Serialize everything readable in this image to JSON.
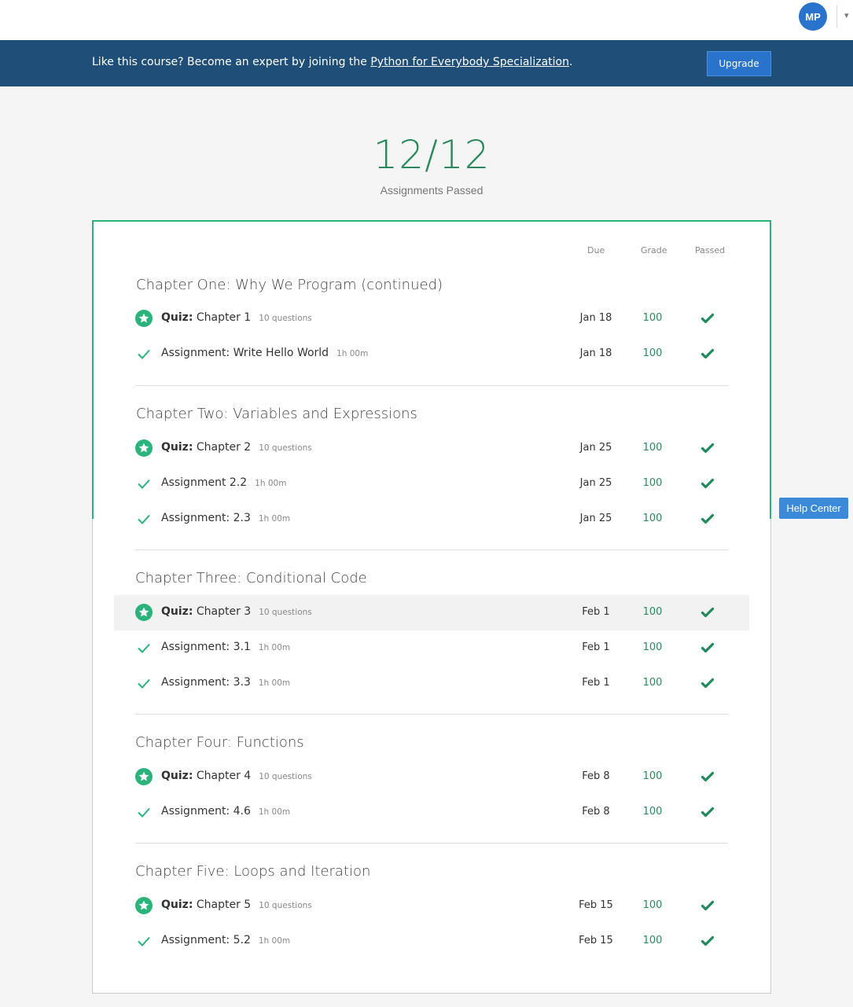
{
  "topbar": {
    "avatar_initials": "MP",
    "dropdown_icon": "chevron-down-icon"
  },
  "banner": {
    "text_before": "Like this course? Become an expert by joining the ",
    "link_text": "Python for Everybody Specialization",
    "text_after": ".",
    "upgrade_label": "Upgrade"
  },
  "summary": {
    "score": "12/12",
    "label": "Assignments Passed"
  },
  "columns": {
    "due": "Due",
    "grade": "Grade",
    "passed": "Passed"
  },
  "colors": {
    "accent": "#2a8a5c",
    "banner": "#1f4e79",
    "button": "#2a73cc",
    "help": "#3b8ad9"
  },
  "chapters": [
    {
      "title": "Chapter One: Why We Program (continued)",
      "items": [
        {
          "kind": "Quiz:",
          "name": "Chapter 1",
          "meta": "10 questions",
          "due": "Jan 18",
          "grade": "100",
          "icon": "star-badge-icon"
        },
        {
          "kind": "",
          "name": "Assignment: Write Hello World",
          "meta": "1h 00m",
          "due": "Jan 18",
          "grade": "100",
          "icon": "check-icon"
        }
      ]
    },
    {
      "title": "Chapter Two: Variables and Expressions",
      "items": [
        {
          "kind": "Quiz:",
          "name": "Chapter 2",
          "meta": "10 questions",
          "due": "Jan 25",
          "grade": "100",
          "icon": "star-badge-icon"
        },
        {
          "kind": "",
          "name": "Assignment 2.2",
          "meta": "1h 00m",
          "due": "Jan 25",
          "grade": "100",
          "icon": "check-icon"
        },
        {
          "kind": "",
          "name": "Assignment: 2.3",
          "meta": "1h 00m",
          "due": "Jan 25",
          "grade": "100",
          "icon": "check-icon"
        }
      ]
    },
    {
      "title": "Chapter Three: Conditional Code",
      "items": [
        {
          "kind": "Quiz:",
          "name": "Chapter 3",
          "meta": "10 questions",
          "due": "Feb 1",
          "grade": "100",
          "icon": "star-badge-icon"
        },
        {
          "kind": "",
          "name": "Assignment: 3.1",
          "meta": "1h 00m",
          "due": "Feb 1",
          "grade": "100",
          "icon": "check-icon"
        },
        {
          "kind": "",
          "name": "Assignment: 3.3",
          "meta": "1h 00m",
          "due": "Feb 1",
          "grade": "100",
          "icon": "check-icon"
        }
      ]
    },
    {
      "title": "Chapter Four: Functions",
      "items": [
        {
          "kind": "Quiz:",
          "name": "Chapter 4",
          "meta": "10 questions",
          "due": "Feb 8",
          "grade": "100",
          "icon": "star-badge-icon"
        },
        {
          "kind": "",
          "name": "Assignment: 4.6",
          "meta": "1h 00m",
          "due": "Feb 8",
          "grade": "100",
          "icon": "check-icon"
        }
      ]
    },
    {
      "title": "Chapter Five: Loops and Iteration",
      "items": [
        {
          "kind": "Quiz:",
          "name": "Chapter 5",
          "meta": "10 questions",
          "due": "Feb 15",
          "grade": "100",
          "icon": "star-badge-icon"
        },
        {
          "kind": "",
          "name": "Assignment: 5.2",
          "meta": "1h 00m",
          "due": "Feb 15",
          "grade": "100",
          "icon": "check-icon"
        }
      ]
    }
  ],
  "help": {
    "label": "Help Center"
  }
}
